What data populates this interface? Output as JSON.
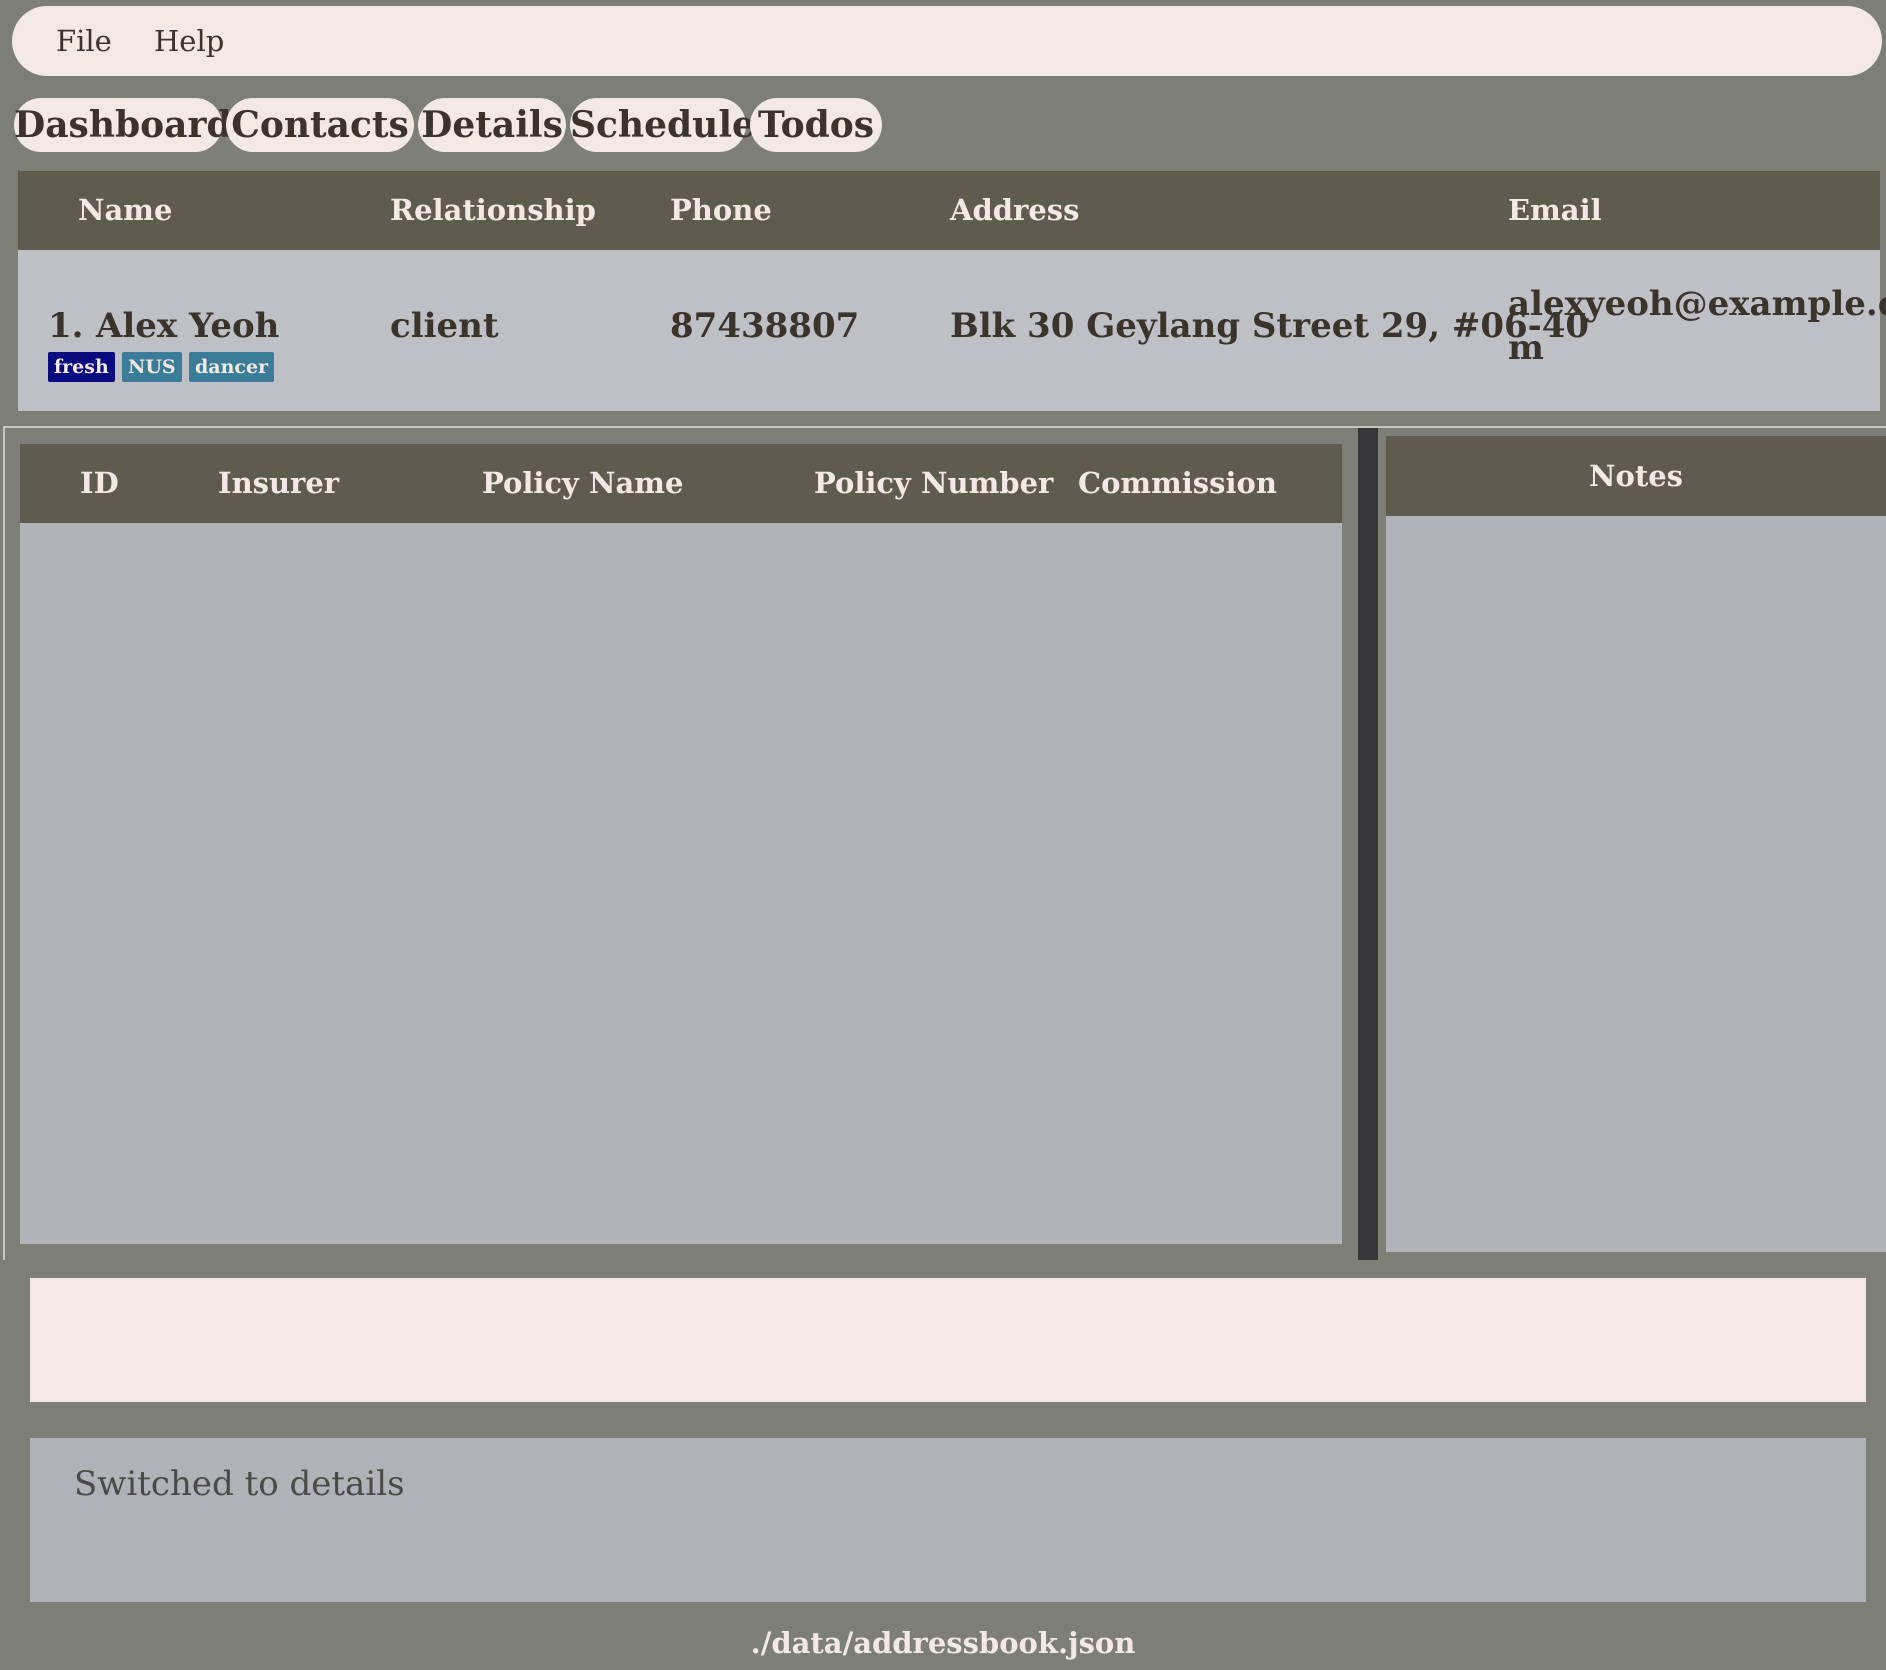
{
  "menubar": {
    "file": "File",
    "help": "Help"
  },
  "tabs": [
    {
      "label": "Dashboard"
    },
    {
      "label": "Contacts"
    },
    {
      "label": "Details"
    },
    {
      "label": "Schedule"
    },
    {
      "label": "Todos"
    }
  ],
  "contact_table": {
    "headers": {
      "name": "Name",
      "relationship": "Relationship",
      "phone": "Phone",
      "address": "Address",
      "email": "Email"
    },
    "rows": [
      {
        "index": "1.",
        "name": "Alex Yeoh",
        "relationship": "client",
        "phone": "87438807",
        "address": "Blk 30 Geylang Street 29, #06-40",
        "email_line1": "alexyeoh@example.co",
        "email_line2": "m",
        "tags": [
          {
            "label": "fresh",
            "color": "#0a0a80"
          },
          {
            "label": "NUS",
            "color": "#3b7c99"
          },
          {
            "label": "dancer",
            "color": "#3b7c99"
          }
        ]
      }
    ]
  },
  "policy_table": {
    "headers": {
      "id": "ID",
      "insurer": "Insurer",
      "policy_name": "Policy Name",
      "policy_number": "Policy Number",
      "commission": "Commission"
    }
  },
  "notes": {
    "title": "Notes"
  },
  "command_box": {
    "value": ""
  },
  "result": {
    "text": "Switched to details"
  },
  "status_bar": {
    "path": "./data/addressbook.json"
  },
  "colors": {
    "background": "#7d7e75",
    "header": "#5e5c4e",
    "light": "#f3e9e4",
    "panel": "#b1b2b7",
    "row": "#bfc0c6"
  }
}
